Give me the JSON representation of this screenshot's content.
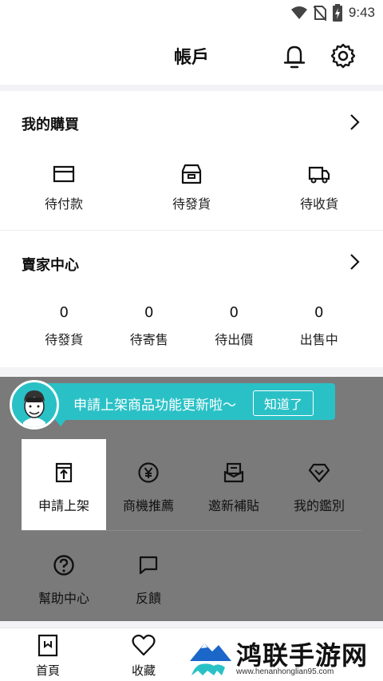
{
  "status_bar": {
    "time": "9:43"
  },
  "header": {
    "title": "帳戶"
  },
  "purchases": {
    "title": "我的購買",
    "items": [
      {
        "label": "待付款",
        "icon": "card-icon"
      },
      {
        "label": "待發貨",
        "icon": "box-icon"
      },
      {
        "label": "待收貨",
        "icon": "truck-icon"
      }
    ]
  },
  "seller": {
    "title": "賣家中心",
    "items": [
      {
        "count": "0",
        "label": "待發貨"
      },
      {
        "count": "0",
        "label": "待寄售"
      },
      {
        "count": "0",
        "label": "待出價"
      },
      {
        "count": "0",
        "label": "出售中"
      }
    ]
  },
  "tooltip": {
    "text": "申請上架商品功能更新啦～",
    "button": "知道了"
  },
  "tools": [
    {
      "label": "申請上架",
      "icon": "apply-listing-icon"
    },
    {
      "label": "商機推薦",
      "icon": "yen-coin-icon"
    },
    {
      "label": "邀新補貼",
      "icon": "invite-icon"
    },
    {
      "label": "我的鑑別",
      "icon": "diamond-icon"
    },
    {
      "label": "幫助中心",
      "icon": "help-icon"
    },
    {
      "label": "反饋",
      "icon": "feedback-icon"
    }
  ],
  "bottom_nav": [
    {
      "label": "首頁",
      "icon": "shopping-bag-icon"
    },
    {
      "label": "收藏",
      "icon": "heart-icon"
    }
  ],
  "watermark": {
    "text": "鸿联手游网",
    "url": "www.henanhonglian95.com"
  },
  "colors": {
    "accent": "#2ac1c6",
    "overlay": "#7a7a7a"
  }
}
